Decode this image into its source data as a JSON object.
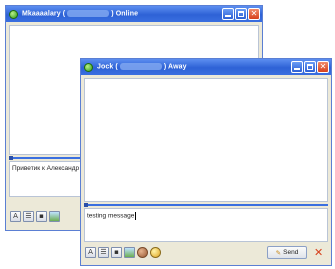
{
  "back_window": {
    "title_name": "Mkaaaalary (",
    "title_suffix": ") Online",
    "input_text": "Приветик к Александр"
  },
  "front_window": {
    "title_name": "Jock (",
    "title_suffix": ") Away",
    "input_text": "testing message",
    "send_label": "Send"
  },
  "icons": {
    "status": "online-status-icon",
    "minimize": "minimize-icon",
    "maximize": "maximize-icon",
    "close": "close-icon"
  },
  "colors": {
    "titlebar": "#2e62d6",
    "online": "#2f9b16",
    "close": "#d6401c"
  }
}
